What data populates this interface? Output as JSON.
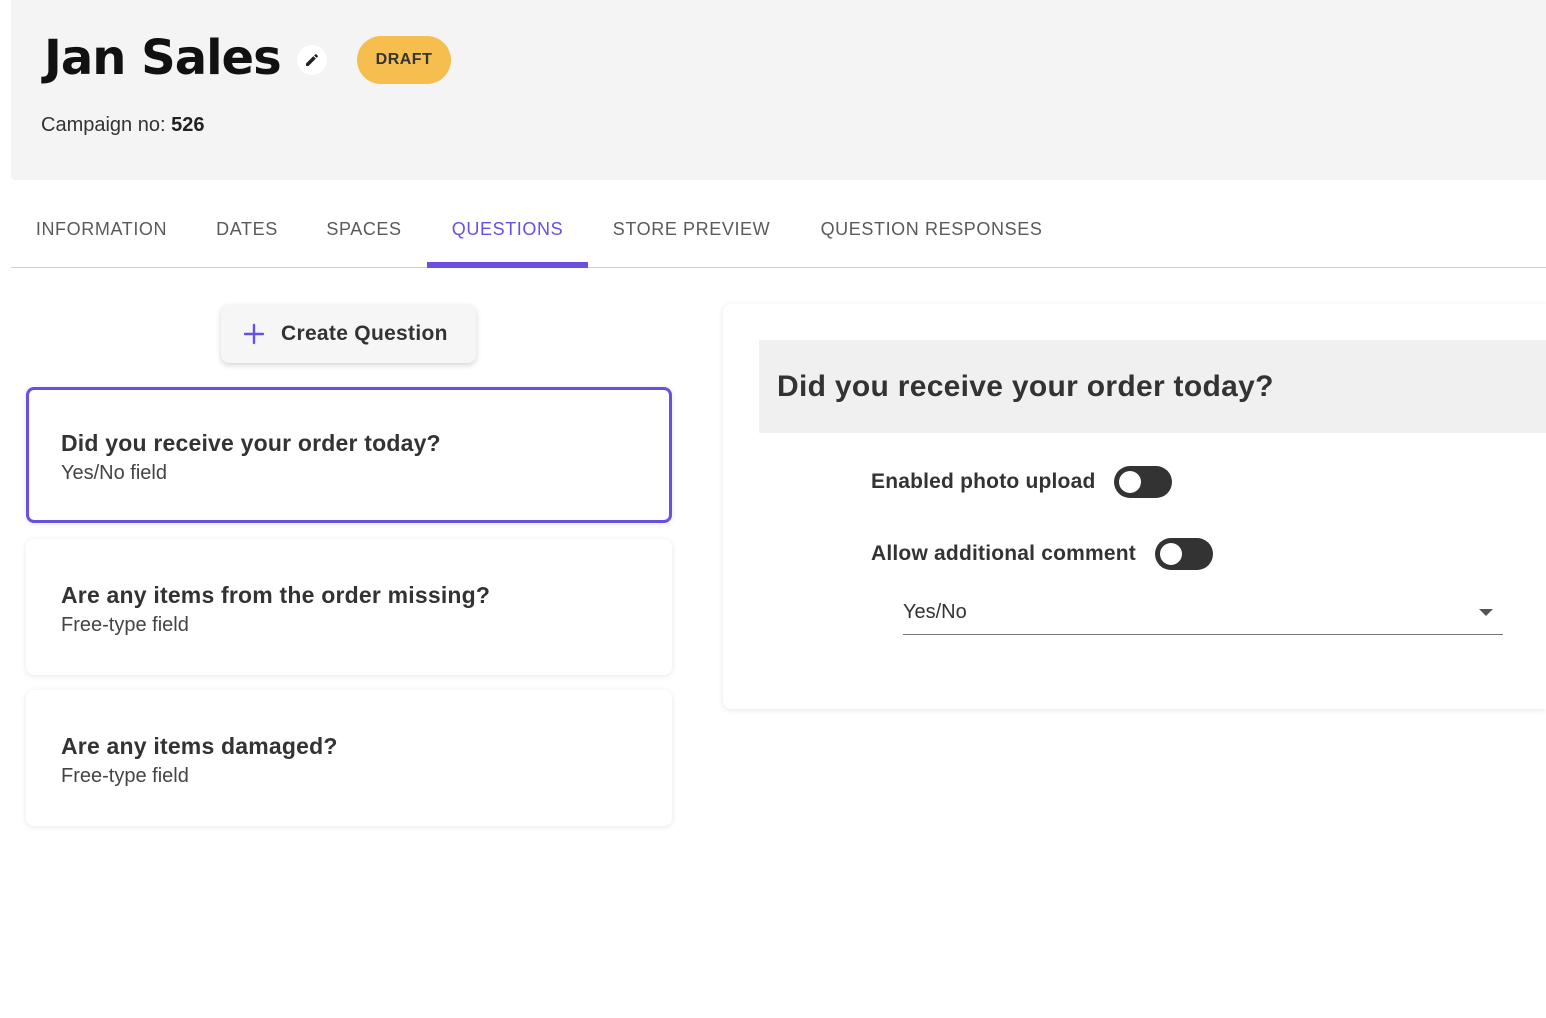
{
  "header": {
    "title": "Jan Sales",
    "status": "DRAFT",
    "campaign_label": "Campaign no: ",
    "campaign_number": "526"
  },
  "tabs": [
    {
      "label": "INFORMATION"
    },
    {
      "label": "DATES"
    },
    {
      "label": "SPACES"
    },
    {
      "label": "QUESTIONS"
    },
    {
      "label": "STORE PREVIEW"
    },
    {
      "label": "QUESTION RESPONSES"
    }
  ],
  "active_tab": "QUESTIONS",
  "create_button": {
    "label": "Create Question"
  },
  "questions": [
    {
      "title": "Did you receive your order today?",
      "type": "Yes/No field",
      "selected": true
    },
    {
      "title": "Are any items from the order missing?",
      "type": "Free-type field",
      "selected": false
    },
    {
      "title": "Are any items damaged?",
      "type": "Free-type field",
      "selected": false
    }
  ],
  "detail": {
    "title": "Did you receive your order today?",
    "photo_upload_label": "Enabled photo upload",
    "photo_upload_enabled": false,
    "comment_label": "Allow additional comment",
    "comment_enabled": false,
    "type_value": "Yes/No"
  },
  "colors": {
    "accent": "#6b4fe0",
    "draft_badge": "#f5be4f",
    "header_bg": "#f4f4f4"
  },
  "icons": [
    "pencil-icon",
    "plus-icon",
    "chevron-down-icon"
  ]
}
